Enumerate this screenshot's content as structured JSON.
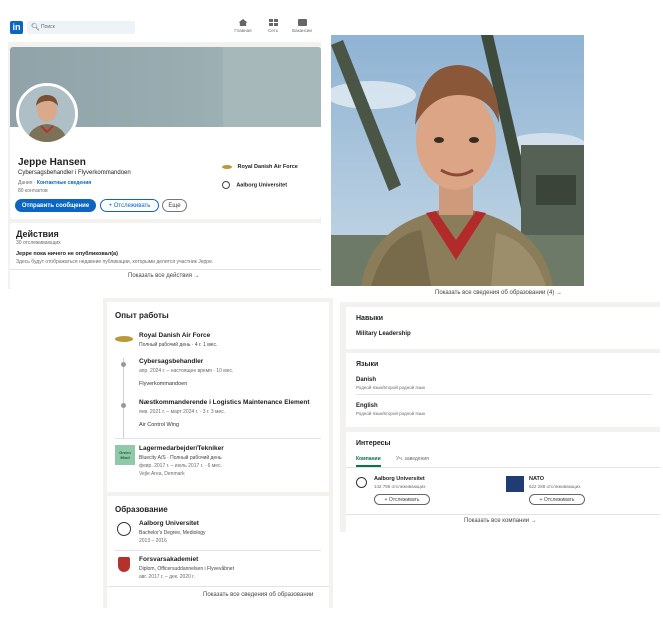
{
  "header": {
    "logo": "in",
    "search_placeholder": "Поиск",
    "nav": [
      {
        "label": "Главная",
        "icon": "home-icon"
      },
      {
        "label": "Сеть",
        "icon": "network-icon"
      },
      {
        "label": "Вакансии",
        "icon": "jobs-icon"
      }
    ]
  },
  "profile": {
    "name": "Jeppe Hansen",
    "headline": "Cybersagsbehandler i Flyverkommandoen",
    "location": "Дания",
    "contact_link": "Контактные сведения",
    "connections": "80 контактов",
    "buttons": {
      "message": "Отправить сообщение",
      "follow": "+ Отслеживать",
      "more": "Еще"
    },
    "side_items": [
      {
        "label": "Royal Danish Air Force"
      },
      {
        "label": "Aalborg Universitet"
      }
    ]
  },
  "activity": {
    "title": "Действия",
    "followers": "30 отслеживающих",
    "empty_title": "Jeppe пока ничего не опубликовал(а)",
    "empty_text": "Здесь будут отображаться недавние публикации, которыми делится участник Jeppe.",
    "show_all": "Показать все действия →"
  },
  "experience": {
    "title": "Опыт работы",
    "company": "Royal Danish Air Force",
    "company_meta": "Полный рабочий день · 4 г. 1 мес.",
    "roles": [
      {
        "title": "Cybersagsbehandler",
        "dates": "апр. 2024 г. – настоящее время · 10 мес.",
        "desc": "Flyverkommandoen"
      },
      {
        "title": "Næstkommanderende i Logistics Maintenance Element",
        "dates": "янв. 2021 г. – март 2024 г. · 3 г. 3 мес.",
        "desc": "Air Control Wing"
      }
    ],
    "second": {
      "logo_text": "Green Mind",
      "title": "Lagermedarbejder/Tekniker",
      "company": "Bluecity A/S · Полный рабочий день",
      "dates": "февр. 2017 г. – июль 2017 г. · 6 мес.",
      "location": "Vejle Area, Denmark"
    }
  },
  "education_left": {
    "title": "Образование",
    "items": [
      {
        "school": "Aalborg Universitet",
        "degree": "Bachelor's Degree, Mediology",
        "dates": "2013 – 2016"
      },
      {
        "school": "Forsvarsakademiet",
        "degree": "Diplom, Officersuddannelsen i Flyvevåbnet",
        "dates": "авг. 2017 г. – дек. 2020 г."
      }
    ],
    "show_all": "Показать все сведения об образовании"
  },
  "right": {
    "education_show_all": "Показать все сведения об образовании (4) →",
    "skills": {
      "title": "Навыки",
      "item": "Military Leadership"
    },
    "languages": {
      "title": "Языки",
      "items": [
        {
          "name": "Danish",
          "level": "Родной язык/второй родной язык"
        },
        {
          "name": "English",
          "level": "Родной язык/второй родной язык"
        }
      ]
    },
    "interests": {
      "title": "Интересы",
      "tabs": [
        "Компании",
        "Уч. заведения"
      ],
      "items": [
        {
          "name": "Aalborg Universitet",
          "followers": "142 786 отслеживающих",
          "button": "+ Отслеживать"
        },
        {
          "name": "NATO",
          "followers": "622 288 отслеживающих",
          "button": "+ Отслеживать"
        }
      ],
      "show_all": "Показать все компании →"
    }
  },
  "colors": {
    "brand": "#0a66c2",
    "background_gray": "#f3f2ef",
    "banner": "#8fa3a8"
  }
}
